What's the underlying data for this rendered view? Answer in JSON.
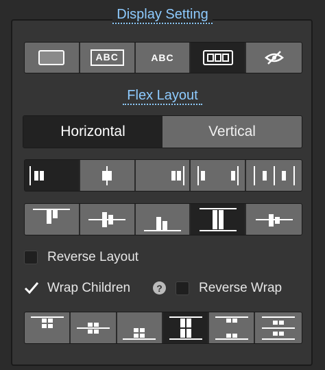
{
  "display": {
    "title": "Display Setting",
    "options": [
      {
        "name": "block",
        "label": ""
      },
      {
        "name": "inline-block",
        "label": "ABC"
      },
      {
        "name": "inline",
        "label": "ABC"
      },
      {
        "name": "flex",
        "label": "",
        "selected": true
      },
      {
        "name": "none",
        "label": ""
      }
    ]
  },
  "flex": {
    "title": "Flex Layout",
    "direction": {
      "options": [
        "Horizontal",
        "Vertical"
      ],
      "selected": "Horizontal"
    },
    "justify_selected": 0,
    "align_selected": 3,
    "wrap_align_selected": 3
  },
  "checkboxes": {
    "reverse_layout": {
      "label": "Reverse Layout",
      "checked": false
    },
    "wrap_children": {
      "label": "Wrap Children",
      "checked": true
    },
    "reverse_wrap": {
      "label": "Reverse Wrap",
      "checked": false
    },
    "help": "?"
  },
  "colors": {
    "accent": "#8ecbff",
    "button": "#6a6a6a",
    "selected": "#222222",
    "panel": "#353535"
  }
}
